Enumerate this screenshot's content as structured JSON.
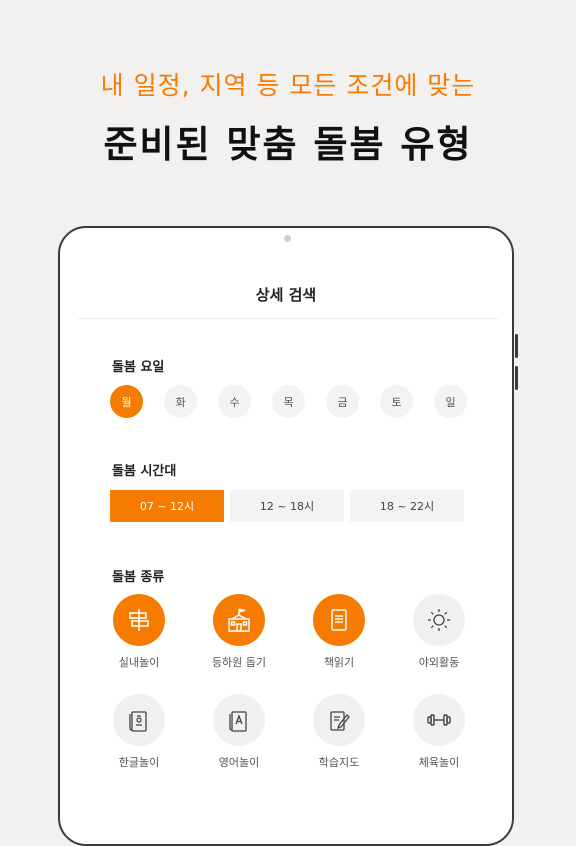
{
  "promo": {
    "subtitle": "내 일정, 지역 등 모든 조건에 맞는",
    "title": "준비된 맞춤 돌봄 유형"
  },
  "screen": {
    "title": "상세 검색",
    "days_label": "돌봄 요일",
    "days": [
      {
        "label": "월",
        "active": true
      },
      {
        "label": "화",
        "active": false
      },
      {
        "label": "수",
        "active": false
      },
      {
        "label": "목",
        "active": false
      },
      {
        "label": "금",
        "active": false
      },
      {
        "label": "토",
        "active": false
      },
      {
        "label": "일",
        "active": false
      }
    ],
    "time_label": "돌봄 시간대",
    "time_slots": [
      {
        "label": "07 ~ 12시",
        "active": true
      },
      {
        "label": "12 ~ 18시",
        "active": false
      },
      {
        "label": "18 ~ 22시",
        "active": false
      }
    ],
    "type_label": "돌봄 종류",
    "types": [
      {
        "label": "실내놀이",
        "icon": "signpost-icon",
        "active": true
      },
      {
        "label": "등하원 돕기",
        "icon": "school-icon",
        "active": true
      },
      {
        "label": "책읽기",
        "icon": "book-icon",
        "active": true
      },
      {
        "label": "야외활동",
        "icon": "sun-icon",
        "active": false
      },
      {
        "label": "한글놀이",
        "icon": "hangul-book-icon",
        "active": false
      },
      {
        "label": "영어놀이",
        "icon": "english-book-icon",
        "active": false
      },
      {
        "label": "학습지도",
        "icon": "notebook-pen-icon",
        "active": false
      },
      {
        "label": "체육놀이",
        "icon": "dumbbell-icon",
        "active": false
      }
    ]
  },
  "colors": {
    "accent": "#f57c00",
    "inactive_bg": "#f3f3f3",
    "background": "#f3f1ef"
  }
}
